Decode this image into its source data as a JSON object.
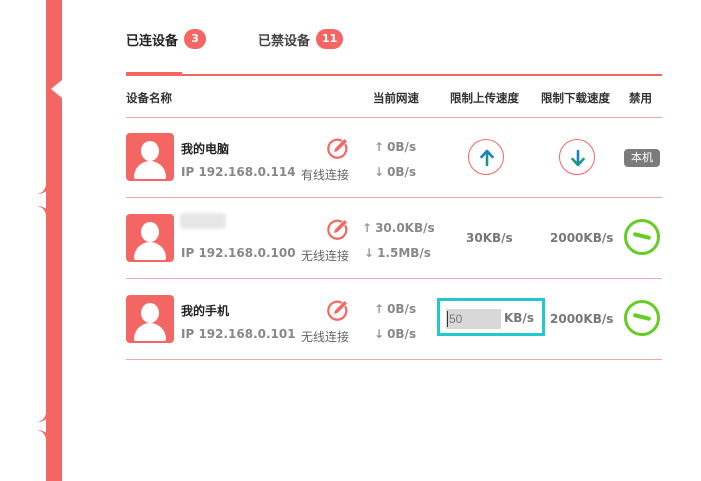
{
  "tabs": {
    "connected_label": "已连设备",
    "connected_count": "3",
    "blocked_label": "已禁设备",
    "blocked_count": "11"
  },
  "table_header": {
    "device_name": "设备名称",
    "current_speed": "当前网速",
    "limit_upload": "限制上传速度",
    "limit_download": "限制下载速度",
    "ban": "禁用"
  },
  "devices": [
    {
      "name": "我的电脑",
      "ip": "IP 192.168.0.114",
      "connection": "有线连接",
      "up_speed": "0B/s",
      "down_speed": "0B/s",
      "local_badge": "本机"
    },
    {
      "name": "",
      "ip": "IP 192.168.0.100",
      "connection": "无线连接",
      "up_speed": "30.0KB/s",
      "down_speed": "1.5MB/s",
      "upload_limit": "30KB/s",
      "download_limit": "2000KB/s"
    },
    {
      "name": "我的手机",
      "ip": "IP 192.168.0.101",
      "connection": "无线连接",
      "up_speed": "0B/s",
      "down_speed": "0B/s",
      "upload_input_value": "50",
      "upload_unit": "KB/s",
      "download_limit": "2000KB/s"
    }
  ],
  "icons": {
    "up_arrow": "↑",
    "down_arrow": "↓"
  },
  "colors": {
    "accent": "#f46664",
    "upload_arrow": "#1a9a7a",
    "download_arrow": "#1a7fc9",
    "ban_green": "#66cc22",
    "focus_cyan": "#22c7cf"
  }
}
